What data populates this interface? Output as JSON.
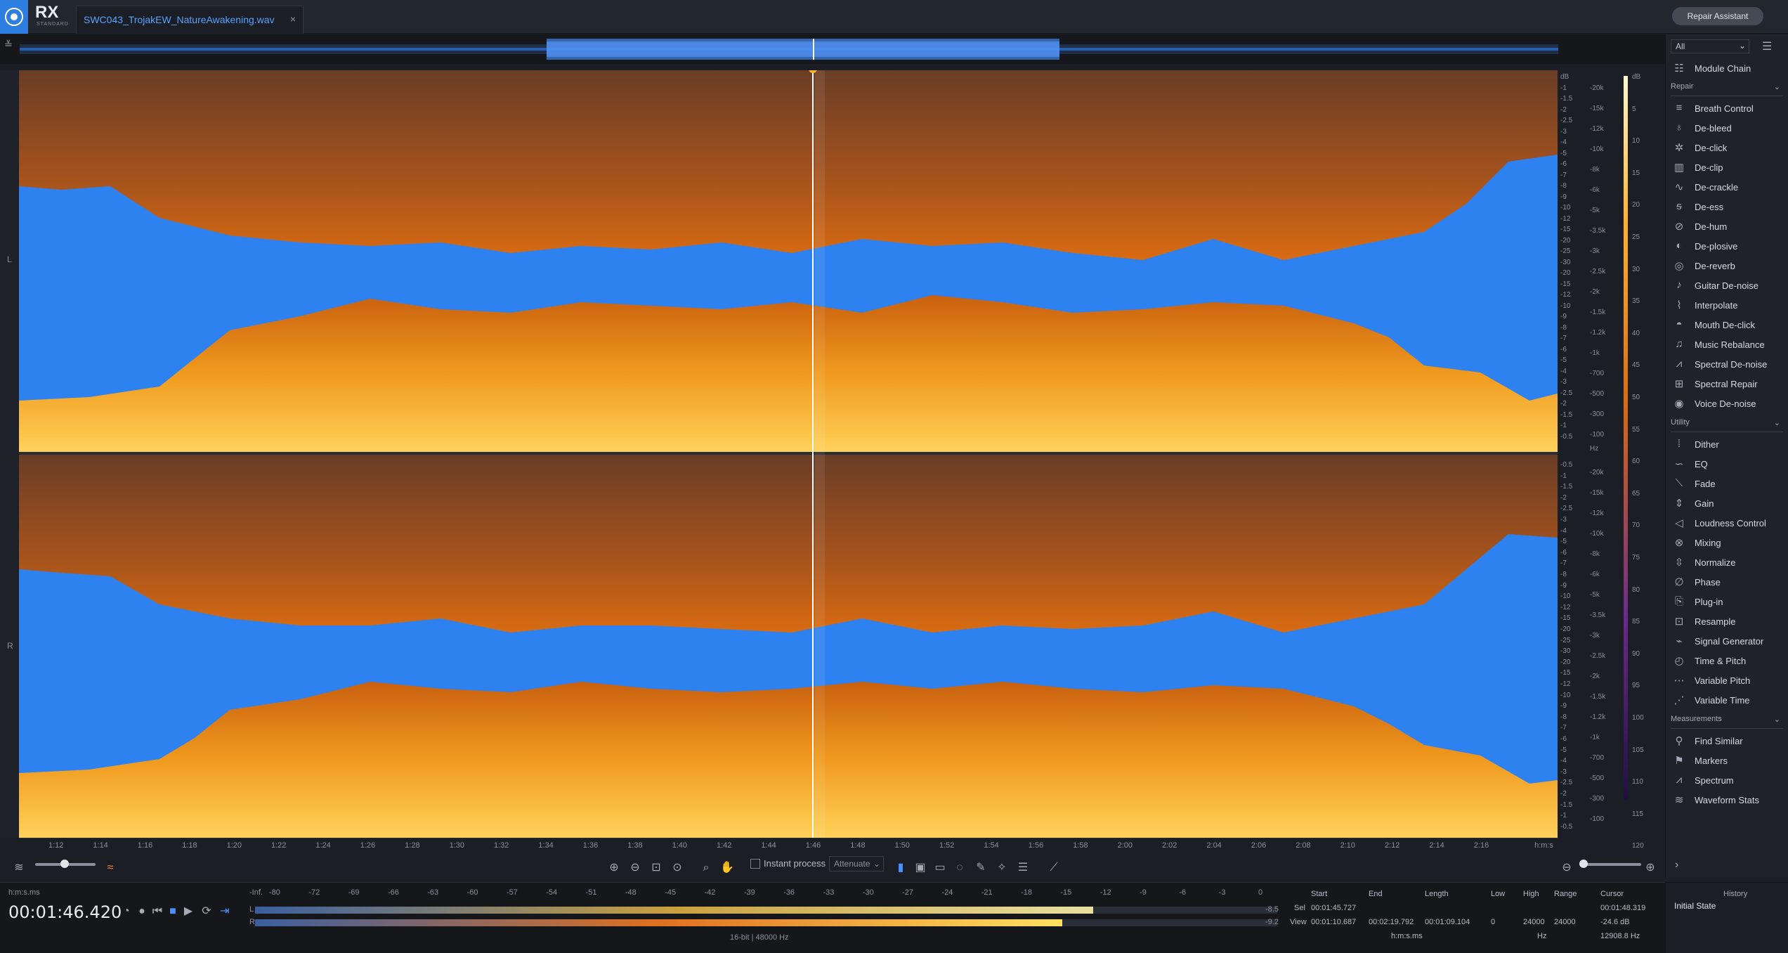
{
  "app": {
    "logo": "RX",
    "edition": "STANDARD"
  },
  "tab": {
    "filename": "SWC043_TrojakEW_NatureAwakening.wav",
    "close": "×"
  },
  "repair_assistant": "Repair Assistant",
  "channels": [
    "L",
    "R"
  ],
  "db_scale": [
    "dB",
    "-1",
    "-1.5",
    "-2",
    "-2.5",
    "-3",
    "-4",
    "-5",
    "-6",
    "-7",
    "-8",
    "-9",
    "-10",
    "-12",
    "-15",
    "-20",
    "-25",
    "-30",
    "-20",
    "-15",
    "-12",
    "-10",
    "-9",
    "-8",
    "-7",
    "-6",
    "-5",
    "-4",
    "-3",
    "-2.5",
    "-2",
    "-1.5",
    "-1",
    "-0.5"
  ],
  "db_scale_lower": [
    "-0.5",
    "-1",
    "-1.5",
    "-2",
    "-2.5",
    "-3",
    "-4",
    "-5",
    "-6",
    "-7",
    "-8",
    "-9",
    "-10",
    "-12",
    "-15",
    "-20",
    "-25",
    "-30",
    "-20",
    "-15",
    "-12",
    "-10",
    "-9",
    "-8",
    "-7",
    "-6",
    "-5",
    "-4",
    "-3",
    "-2.5",
    "-2",
    "-1.5",
    "-1",
    "-0.5"
  ],
  "hz_scale": [
    "-20k",
    "-15k",
    "-12k",
    "-10k",
    "-8k",
    "-6k",
    "-5k",
    "-3.5k",
    "-3k",
    "-2.5k",
    "-2k",
    "-1.5k",
    "-1.2k",
    "-1k",
    "-700",
    "-500",
    "-300",
    "-100",
    "Hz"
  ],
  "color_scale": [
    "dB",
    "5",
    "10",
    "15",
    "20",
    "25",
    "30",
    "35",
    "40",
    "45",
    "50",
    "55",
    "60",
    "65",
    "70",
    "75",
    "80",
    "85",
    "90",
    "95",
    "100",
    "105",
    "110",
    "115",
    "120"
  ],
  "timeline": {
    "ticks": [
      "1:12",
      "1:14",
      "1:16",
      "1:18",
      "1:20",
      "1:22",
      "1:24",
      "1:26",
      "1:28",
      "1:30",
      "1:32",
      "1:34",
      "1:36",
      "1:38",
      "1:40",
      "1:42",
      "1:44",
      "1:46",
      "1:48",
      "1:50",
      "1:52",
      "1:54",
      "1:56",
      "1:58",
      "2:00",
      "2:02",
      "2:04",
      "2:06",
      "2:08",
      "2:10",
      "2:12",
      "2:14",
      "2:16"
    ],
    "unit": "h:m:s"
  },
  "toolbar": {
    "instant_process": "Instant process",
    "attenuate": "Attenuate"
  },
  "status": {
    "time_format": "h:m:s.ms",
    "time": "00:01:46.420",
    "meter_scale": [
      "-Inf.",
      "-80",
      "-72",
      "-69",
      "-66",
      "-63",
      "-60",
      "-57",
      "-54",
      "-51",
      "-48",
      "-45",
      "-42",
      "-39",
      "-36",
      "-33",
      "-30",
      "-27",
      "-24",
      "-21",
      "-18",
      "-15",
      "-12",
      "-9",
      "-6",
      "-3",
      "0"
    ],
    "meter_l_label": "L",
    "meter_r_label": "R",
    "meter_l_peak": "-8.5",
    "meter_r_peak": "-9.2",
    "meter_l_level": 0.82,
    "meter_r_level": 0.79,
    "format": "16-bit | 48000 Hz",
    "selection": {
      "headers": [
        "Start",
        "End",
        "Length",
        "Low",
        "High",
        "Range",
        "Cursor"
      ],
      "sel_label": "Sel",
      "view_label": "View",
      "sel": [
        "00:01:45.727",
        "",
        "",
        "",
        "",
        "",
        "00:01:48.319"
      ],
      "view": [
        "00:01:10.687",
        "00:02:19.792",
        "00:01:09.104",
        "0",
        "24000",
        "24000",
        "-24.6 dB"
      ],
      "units": [
        "h:m:s.ms",
        "Hz"
      ],
      "cursor_hz": "12908.8 Hz"
    }
  },
  "panel": {
    "filter": "All",
    "module_chain": "Module Chain",
    "groups": [
      {
        "title": "Repair",
        "items": [
          "Breath Control",
          "De-bleed",
          "De-click",
          "De-clip",
          "De-crackle",
          "De-ess",
          "De-hum",
          "De-plosive",
          "De-reverb",
          "Guitar De-noise",
          "Interpolate",
          "Mouth De-click",
          "Music Rebalance",
          "Spectral De-noise",
          "Spectral Repair",
          "Voice De-noise"
        ]
      },
      {
        "title": "Utility",
        "items": [
          "Dither",
          "EQ",
          "Fade",
          "Gain",
          "Loudness Control",
          "Mixing",
          "Normalize",
          "Phase",
          "Plug-in",
          "Resample",
          "Signal Generator",
          "Time & Pitch",
          "Variable Pitch",
          "Variable Time"
        ]
      },
      {
        "title": "Measurements",
        "items": [
          "Find Similar",
          "Markers",
          "Spectrum",
          "Waveform Stats"
        ]
      }
    ],
    "history_title": "History",
    "history_item": "Initial State"
  }
}
